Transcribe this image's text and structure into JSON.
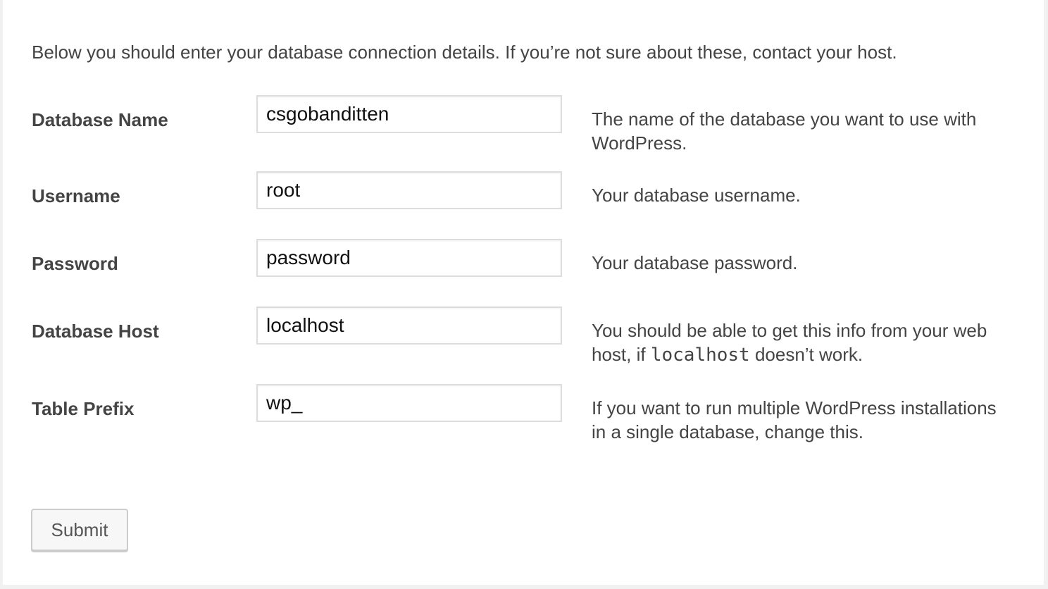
{
  "intro_text": "Below you should enter your database connection details. If you’re not sure about these, contact your host.",
  "fields": [
    {
      "label": "Database Name",
      "value": "csgobanditten",
      "description": "The name of the database you want to use with WordPress."
    },
    {
      "label": "Username",
      "value": "root",
      "description": "Your database username."
    },
    {
      "label": "Password",
      "value": "password",
      "description": "Your database password."
    },
    {
      "label": "Database Host",
      "value": "localhost",
      "description_before": "You should be able to get this info from your web host, if ",
      "description_code": "localhost",
      "description_after": " doesn’t work."
    },
    {
      "label": "Table Prefix",
      "value": "wp_",
      "description": "If you want to run multiple WordPress installations in a single database, change this."
    }
  ],
  "submit_label": "Submit"
}
